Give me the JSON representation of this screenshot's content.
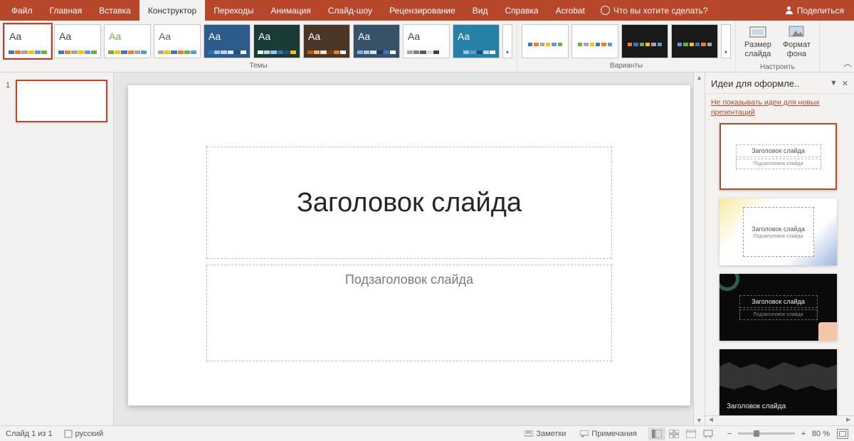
{
  "tabs": [
    "Файл",
    "Главная",
    "Вставка",
    "Конструктор",
    "Переходы",
    "Анимация",
    "Слайд-шоу",
    "Рецензирование",
    "Вид",
    "Справка",
    "Acrobat"
  ],
  "active_tab": 3,
  "tell_me": "Что вы хотите сделать?",
  "share": "Поделиться",
  "ribbon": {
    "themes_label": "Темы",
    "variants_label": "Варианты",
    "customize_label": "Настроить",
    "slide_size": "Размер\nслайда",
    "background": "Формат\nфона"
  },
  "slide": {
    "number": "1",
    "title_placeholder": "Заголовок слайда",
    "subtitle_placeholder": "Подзаголовок слайда"
  },
  "design_pane": {
    "title": "Идеи для оформле..",
    "hide_link": "Не показывать идеи для новых презентаций",
    "idea_title": "Заголовок слайда",
    "idea_sub": "Подзаголовок слайда"
  },
  "status": {
    "slide_of": "Слайд 1 из 1",
    "language": "русский",
    "notes": "Заметки",
    "comments": "Примечания",
    "zoom": "80 %"
  },
  "theme_colors": [
    [
      "#4472c4",
      "#ed7d31",
      "#a5a5a5",
      "#ffc000",
      "#5b9bd5",
      "#70ad47"
    ],
    [
      "#4472c4",
      "#ed7d31",
      "#a5a5a5",
      "#ffc000",
      "#5b9bd5",
      "#70ad47"
    ],
    [
      "#70ad47",
      "#ffc000",
      "#4472c4",
      "#ed7d31",
      "#a5a5a5",
      "#5b9bd5"
    ],
    [
      "#a5a5a5",
      "#ffc000",
      "#4472c4",
      "#ed7d31",
      "#70ad47",
      "#5b9bd5"
    ],
    [
      "#2e75b6",
      "#9dc3e6",
      "#bdd7ee",
      "#deebf7",
      "#1f4e79",
      "#fff"
    ],
    [
      "#fff",
      "#bdd7ee",
      "#9dc3e6",
      "#2e75b6",
      "#1f4e79",
      "#ffc000"
    ],
    [
      "#c55a11",
      "#f4b183",
      "#fbe5d6",
      "#843c0c",
      "#ed7d31",
      "#fff"
    ],
    [
      "#8faadc",
      "#b4c7e7",
      "#dae3f3",
      "#203864",
      "#4472c4",
      "#fff"
    ],
    [
      "#a5a5a5",
      "#7f7f7f",
      "#595959",
      "#d9d9d9",
      "#404040",
      "#fff"
    ],
    [
      "#2e75b6",
      "#9dc3e6",
      "#5b9bd5",
      "#1f4e79",
      "#bdd7ee",
      "#fff"
    ]
  ],
  "theme_bg": [
    "#fff",
    "#fff",
    "#fff",
    "#fff",
    "#2e5c8a",
    "#1b3b36",
    "#4a3728",
    "#375268",
    "#fff",
    "#2780a8"
  ],
  "theme_aa": [
    "#444",
    "#444",
    "#70ad47",
    "#666",
    "#fff",
    "#fff",
    "#fff",
    "#fff",
    "#444",
    "#fff"
  ]
}
